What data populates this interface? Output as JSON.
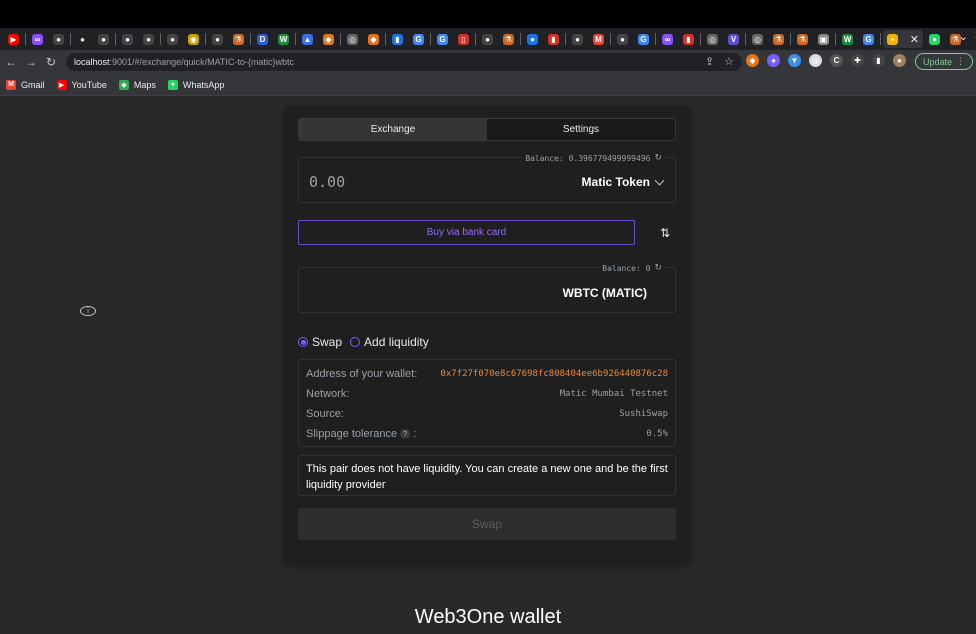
{
  "browser": {
    "url_host": "localhost",
    "url_path": ":9001/#/exchange/quick/MATIC-to-{matic}wbtc",
    "update_label": "Update",
    "new_tab_symbol": "+",
    "tab_close_symbol": "✕",
    "tab_menu_symbol": "⌄",
    "tabs": [
      {
        "icon": "youtube-icon",
        "glyph": "▶",
        "color": "#ff0000"
      },
      {
        "icon": "link-icon",
        "glyph": "∞",
        "color": "#8a4fff"
      },
      {
        "icon": "github-icon",
        "glyph": "●",
        "color": "#444444"
      },
      {
        "icon": "github-icon",
        "glyph": "●",
        "color": "#222222"
      },
      {
        "icon": "github-icon",
        "glyph": "●",
        "color": "#444444"
      },
      {
        "icon": "github-icon",
        "glyph": "●",
        "color": "#444444"
      },
      {
        "icon": "github-icon",
        "glyph": "●",
        "color": "#444444"
      },
      {
        "icon": "github-icon",
        "glyph": "●",
        "color": "#444444"
      },
      {
        "icon": "coin-icon",
        "glyph": "◉",
        "color": "#c4a000"
      },
      {
        "icon": "github-icon",
        "glyph": "●",
        "color": "#444444"
      },
      {
        "icon": "flask-icon",
        "glyph": "⚗",
        "color": "#c96a2a"
      },
      {
        "icon": "dev-icon",
        "glyph": "D",
        "color": "#2b5cd8"
      },
      {
        "icon": "w-icon",
        "glyph": "W",
        "color": "#1e8e3e"
      },
      {
        "icon": "triangle-icon",
        "glyph": "▲",
        "color": "#3b6fe0"
      },
      {
        "icon": "metamask-icon",
        "glyph": "◆",
        "color": "#e2761b"
      },
      {
        "icon": "globe-icon",
        "glyph": "◎",
        "color": "#666666"
      },
      {
        "icon": "metamask-icon",
        "glyph": "◆",
        "color": "#e2761b"
      },
      {
        "icon": "doc-icon",
        "glyph": "▮",
        "color": "#1a73e8"
      },
      {
        "icon": "google-icon",
        "glyph": "G",
        "color": "#4285f4"
      },
      {
        "icon": "google-icon",
        "glyph": "G",
        "color": "#4285f4"
      },
      {
        "icon": "book-icon",
        "glyph": "▯",
        "color": "#d93025"
      },
      {
        "icon": "github-icon",
        "glyph": "●",
        "color": "#444444"
      },
      {
        "icon": "flask-icon",
        "glyph": "⚗",
        "color": "#c96a2a"
      },
      {
        "icon": "blue-circle-icon",
        "glyph": "●",
        "color": "#1a73e8"
      },
      {
        "icon": "red-doc-icon",
        "glyph": "▮",
        "color": "#d93025"
      },
      {
        "icon": "github-icon",
        "glyph": "●",
        "color": "#444444"
      },
      {
        "icon": "gmail-icon",
        "glyph": "M",
        "color": "#ea4335"
      },
      {
        "icon": "github-icon",
        "glyph": "●",
        "color": "#444444"
      },
      {
        "icon": "google-icon",
        "glyph": "G",
        "color": "#4285f4"
      },
      {
        "icon": "link-icon",
        "glyph": "∞",
        "color": "#8a4fff"
      },
      {
        "icon": "red-doc-icon",
        "glyph": "▮",
        "color": "#d93025"
      },
      {
        "icon": "globe-icon",
        "glyph": "◎",
        "color": "#666666"
      },
      {
        "icon": "v-icon",
        "glyph": "V",
        "color": "#5b4fcf"
      },
      {
        "icon": "globe-icon",
        "glyph": "◎",
        "color": "#666666"
      },
      {
        "icon": "flask-icon",
        "glyph": "⚗",
        "color": "#c96a2a"
      },
      {
        "icon": "flask-icon",
        "glyph": "⚗",
        "color": "#c96a2a"
      },
      {
        "icon": "robot-icon",
        "glyph": "▣",
        "color": "#888888"
      },
      {
        "icon": "w-icon",
        "glyph": "W",
        "color": "#1e8e3e"
      },
      {
        "icon": "google-icon",
        "glyph": "G",
        "color": "#4285f4"
      }
    ],
    "after_active_tabs": [
      {
        "icon": "whatsapp-icon",
        "glyph": "●",
        "color": "#25d366"
      },
      {
        "icon": "flask-icon",
        "glyph": "⚗",
        "color": "#c96a2a"
      }
    ],
    "active_tab": {
      "icon": "app-icon",
      "glyph": "▪",
      "color": "#f1b400"
    },
    "extensions": [
      {
        "icon": "metamask-icon",
        "glyph": "◆",
        "color": "#e2761b"
      },
      {
        "icon": "purple-ext-icon",
        "glyph": "●",
        "color": "#7c5cff"
      },
      {
        "icon": "shield-ext-icon",
        "glyph": "▼",
        "color": "#3b8eea"
      },
      {
        "icon": "circle-ext-icon",
        "glyph": "◎",
        "color": "#dddddd"
      },
      {
        "icon": "ci-ext-icon",
        "glyph": "C",
        "color": "#555555"
      },
      {
        "icon": "puzzle-icon",
        "glyph": "✚",
        "color": "#444444"
      },
      {
        "icon": "sidepanel-icon",
        "glyph": "▮",
        "color": "#444444"
      },
      {
        "icon": "profile-avatar-icon",
        "glyph": "●",
        "color": "#a08060"
      }
    ]
  },
  "bookmarks": [
    {
      "label": "Gmail",
      "icon": "gmail-icon",
      "glyph": "M",
      "color": "#ea4335"
    },
    {
      "label": "YouTube",
      "icon": "youtube-icon",
      "glyph": "▶",
      "color": "#ff0000"
    },
    {
      "label": "Maps",
      "icon": "maps-icon",
      "glyph": "◆",
      "color": "#34a853"
    },
    {
      "label": "WhatsApp",
      "icon": "whatsapp-icon",
      "glyph": "●",
      "color": "#25d366"
    }
  ],
  "exchange": {
    "tabs": {
      "exchange": "Exchange",
      "settings": "Settings"
    },
    "from": {
      "balance": "Balance: 0.396779499999496",
      "amount_placeholder": "0.00",
      "token": "Matic Token"
    },
    "buy_button": "Buy via bank card",
    "to": {
      "balance": "Balance: 0",
      "token": "WBTC (MATIC)"
    },
    "mode": {
      "swap": "Swap",
      "add_liquidity": "Add liquidity",
      "selected": "swap"
    },
    "details": {
      "wallet_label": "Address of your wallet:",
      "wallet_value": "0x7f27f070e8c67698fc808404ee6b926440876c28",
      "network_label": "Network:",
      "network_value": "Matic Mumbai Testnet",
      "source_label": "Source:",
      "source_value": "SushiSwap",
      "slippage_label": "Slippage tolerance",
      "slippage_suffix": ":",
      "slippage_help": "?",
      "slippage_value": "0.5%"
    },
    "warning": "This pair does not have liquidity. You can create a new one and be the first liquidity provider",
    "swap_button": "Swap"
  },
  "footer_title": "Web3One wallet",
  "colors": {
    "accent": "#7c5cff",
    "address": "#e8893a",
    "background": "#28292a",
    "card": "#1f1f1f"
  }
}
